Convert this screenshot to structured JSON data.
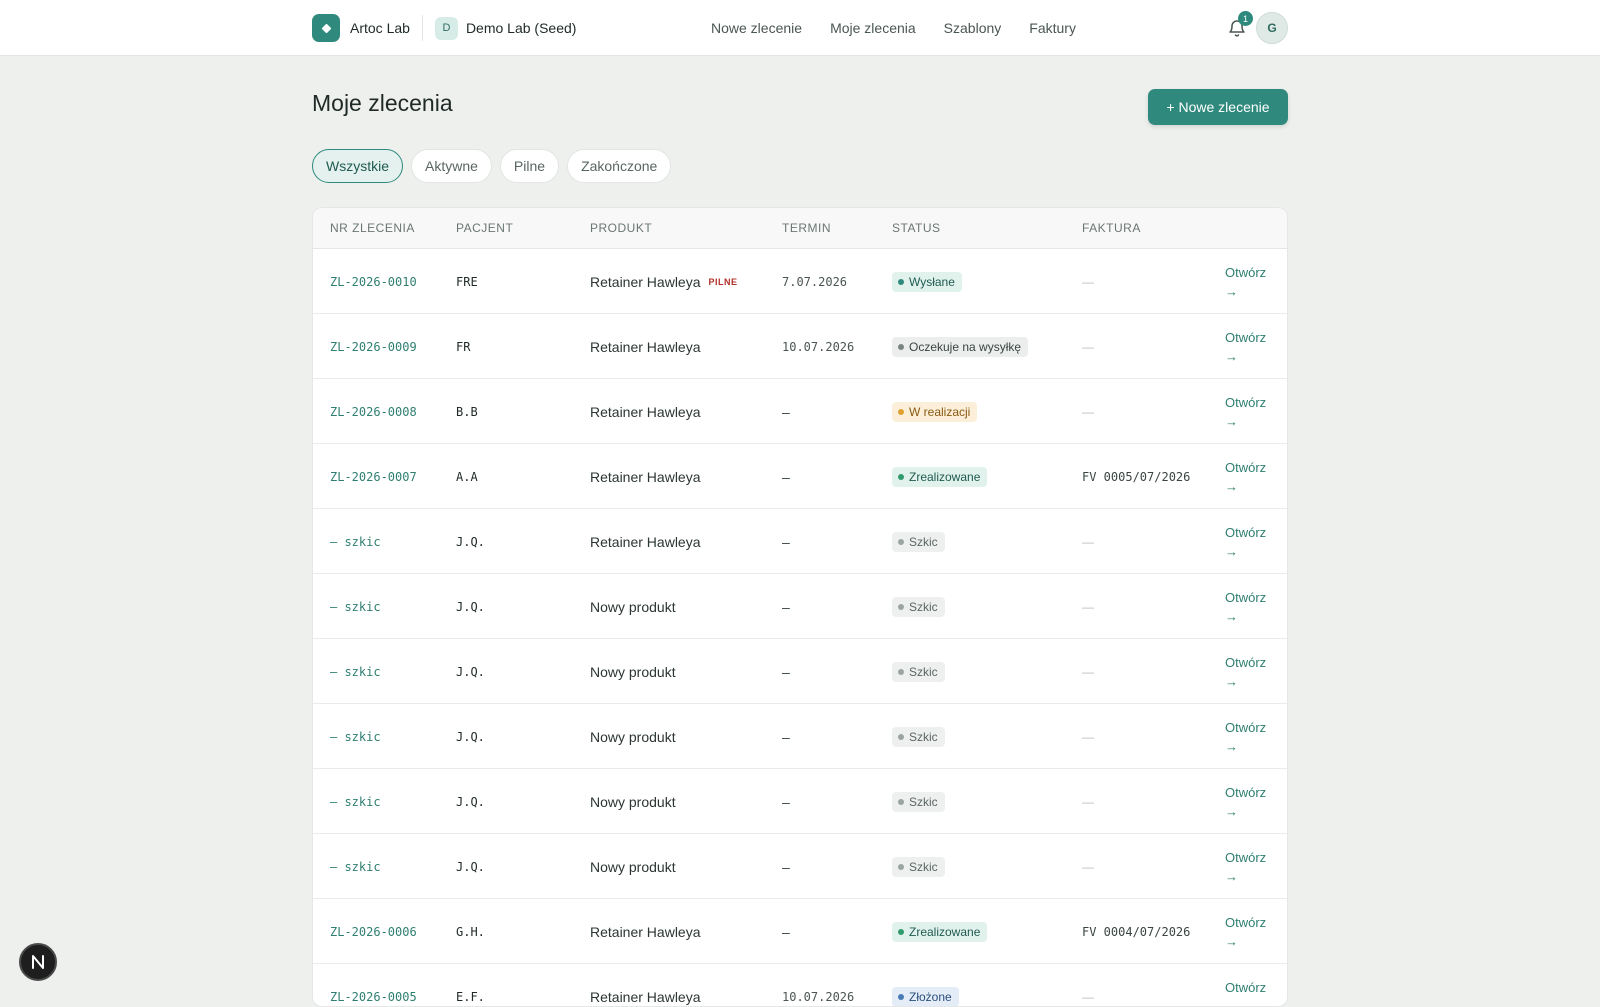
{
  "app": {
    "brand": "Artoc Lab",
    "org_initial": "D",
    "org_name": "Demo Lab (Seed)",
    "notifications": "1",
    "user_initial": "G"
  },
  "nav": [
    {
      "label": "Nowe zlecenie"
    },
    {
      "label": "Moje zlecenia"
    },
    {
      "label": "Szablony"
    },
    {
      "label": "Faktury"
    }
  ],
  "page": {
    "title": "Moje zlecenia",
    "new_button": "+ Nowe zlecenie"
  },
  "tabs": [
    {
      "label": "Wszystkie",
      "active": true
    },
    {
      "label": "Aktywne",
      "active": false
    },
    {
      "label": "Pilne",
      "active": false
    },
    {
      "label": "Zakończone",
      "active": false
    }
  ],
  "columns": {
    "nr": "NR ZLECENIA",
    "patient": "PACJENT",
    "product": "PRODUKT",
    "termin": "TERMIN",
    "status": "STATUS",
    "invoice": "FAKTURA"
  },
  "status_colors": {
    "Wysłane": {
      "bg": "#e1f2ec",
      "fg": "#1f5a50",
      "dot": "#2f8a7d"
    },
    "Oczekuje na wysyłkę": {
      "bg": "#eceeed",
      "fg": "#3a4541",
      "dot": "#7a8580"
    },
    "W realizacji": {
      "bg": "#fbefd9",
      "fg": "#8a5a12",
      "dot": "#e0a030"
    },
    "Zrealizowane": {
      "bg": "#e1f2ec",
      "fg": "#1f5a50",
      "dot": "#2f9a6d"
    },
    "Szkic": {
      "bg": "#eef0ef",
      "fg": "#5a6662",
      "dot": "#9aa4a0"
    },
    "Złożone": {
      "bg": "#e3ecf7",
      "fg": "#2a4e7a",
      "dot": "#4a7ab5"
    }
  },
  "rows": [
    {
      "nr": "ZL-2026-0010",
      "patient": "FRE",
      "product": "Retainer Hawleya",
      "urgent": "PILNE",
      "termin": "7.07.2026",
      "status": "Wysłane",
      "invoice": "—",
      "action": "Otwórz",
      "arrow": "→"
    },
    {
      "nr": "ZL-2026-0009",
      "patient": "FR",
      "product": "Retainer Hawleya",
      "urgent": "",
      "termin": "10.07.2026",
      "status": "Oczekuje na wysyłkę",
      "invoice": "—",
      "action": "Otwórz",
      "arrow": "→"
    },
    {
      "nr": "ZL-2026-0008",
      "patient": "B.B",
      "product": "Retainer Hawleya",
      "urgent": "",
      "termin": "–",
      "status": "W realizacji",
      "invoice": "—",
      "action": "Otwórz",
      "arrow": "→"
    },
    {
      "nr": "ZL-2026-0007",
      "patient": "A.A",
      "product": "Retainer Hawleya",
      "urgent": "",
      "termin": "–",
      "status": "Zrealizowane",
      "invoice": "FV 0005/07/2026",
      "action": "Otwórz",
      "arrow": "→"
    },
    {
      "nr": "— szkic",
      "patient": "J.Q.",
      "product": "Retainer Hawleya",
      "urgent": "",
      "termin": "–",
      "status": "Szkic",
      "invoice": "—",
      "action": "Otwórz",
      "arrow": "→"
    },
    {
      "nr": "— szkic",
      "patient": "J.Q.",
      "product": "Nowy produkt",
      "urgent": "",
      "termin": "–",
      "status": "Szkic",
      "invoice": "—",
      "action": "Otwórz",
      "arrow": "→"
    },
    {
      "nr": "— szkic",
      "patient": "J.Q.",
      "product": "Nowy produkt",
      "urgent": "",
      "termin": "–",
      "status": "Szkic",
      "invoice": "—",
      "action": "Otwórz",
      "arrow": "→"
    },
    {
      "nr": "— szkic",
      "patient": "J.Q.",
      "product": "Nowy produkt",
      "urgent": "",
      "termin": "–",
      "status": "Szkic",
      "invoice": "—",
      "action": "Otwórz",
      "arrow": "→"
    },
    {
      "nr": "— szkic",
      "patient": "J.Q.",
      "product": "Nowy produkt",
      "urgent": "",
      "termin": "–",
      "status": "Szkic",
      "invoice": "—",
      "action": "Otwórz",
      "arrow": "→"
    },
    {
      "nr": "— szkic",
      "patient": "J.Q.",
      "product": "Nowy produkt",
      "urgent": "",
      "termin": "–",
      "status": "Szkic",
      "invoice": "—",
      "action": "Otwórz",
      "arrow": "→"
    },
    {
      "nr": "ZL-2026-0006",
      "patient": "G.H.",
      "product": "Retainer Hawleya",
      "urgent": "",
      "termin": "–",
      "status": "Zrealizowane",
      "invoice": "FV 0004/07/2026",
      "action": "Otwórz",
      "arrow": "→"
    },
    {
      "nr": "ZL-2026-0005",
      "patient": "E.F.",
      "product": "Retainer Hawleya",
      "urgent": "",
      "termin": "10.07.2026",
      "status": "Złożone",
      "invoice": "—",
      "action": "Otwórz",
      "arrow": "→"
    }
  ],
  "dev_indicator": "N"
}
